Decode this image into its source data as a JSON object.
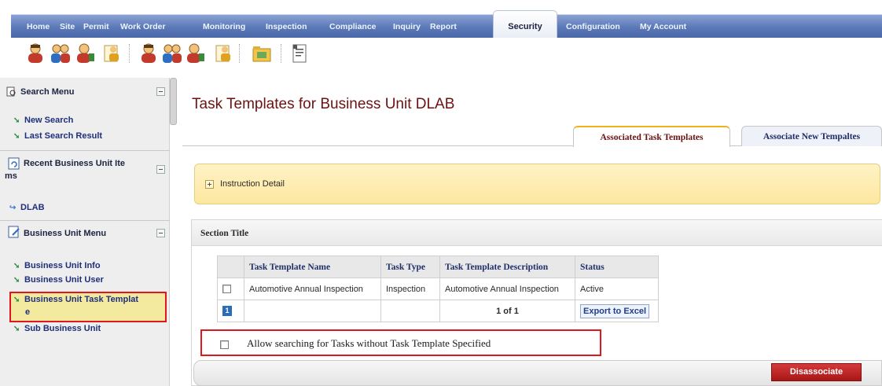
{
  "nav": {
    "items": [
      {
        "label": "Home",
        "name": "nav-home"
      },
      {
        "label": "Site",
        "name": "nav-site"
      },
      {
        "label": "Permit",
        "name": "nav-permit"
      },
      {
        "label": "Work Order",
        "name": "nav-work-order"
      },
      {
        "label": "Monitoring",
        "name": "nav-monitoring"
      },
      {
        "label": "Inspection",
        "name": "nav-inspection"
      },
      {
        "label": "Compliance",
        "name": "nav-compliance"
      },
      {
        "label": "Inquiry",
        "name": "nav-inquiry"
      },
      {
        "label": "Report",
        "name": "nav-report"
      },
      {
        "label": "Configuration",
        "name": "nav-configuration"
      },
      {
        "label": "My Account",
        "name": "nav-my-account"
      }
    ],
    "active": "Security"
  },
  "sidebar": {
    "search_menu": {
      "title": "Search Menu",
      "links": [
        "New Search",
        "Last Search Result"
      ]
    },
    "recent": {
      "title_line1": "Recent Business Unit Ite",
      "title_line2": "ms",
      "items": [
        "DLAB"
      ]
    },
    "bu_menu": {
      "title": "Business Unit Menu",
      "links": [
        "Business Unit Info",
        "Business Unit User",
        "Business Unit Task Templat",
        "e",
        "Sub Business Unit"
      ]
    }
  },
  "main": {
    "title": "Task Templates for Business Unit DLAB",
    "tabs": [
      "Associated Task Templates",
      "Associate New Tempaltes"
    ],
    "instruction_label": "Instruction Detail",
    "section_title": "Section Title",
    "table": {
      "headers": [
        "Task Template Name",
        "Task Type",
        "Task Template Description",
        "Status"
      ],
      "rows": [
        [
          "Automotive Annual Inspection",
          "Inspection",
          "Automotive Annual Inspection",
          "Active"
        ]
      ],
      "page_number": "1",
      "page_info": "1 of 1",
      "export_label": "Export to Excel"
    },
    "allow_search_label": "Allow searching for Tasks without Task Template Specified",
    "disassociate_label": "Disassociate"
  },
  "colors": {
    "nav": "#5b79b8",
    "title": "#6b1212",
    "highlight": "#e1161f",
    "button": "#b81e1e",
    "instruction_bg": "#fde7a0"
  }
}
